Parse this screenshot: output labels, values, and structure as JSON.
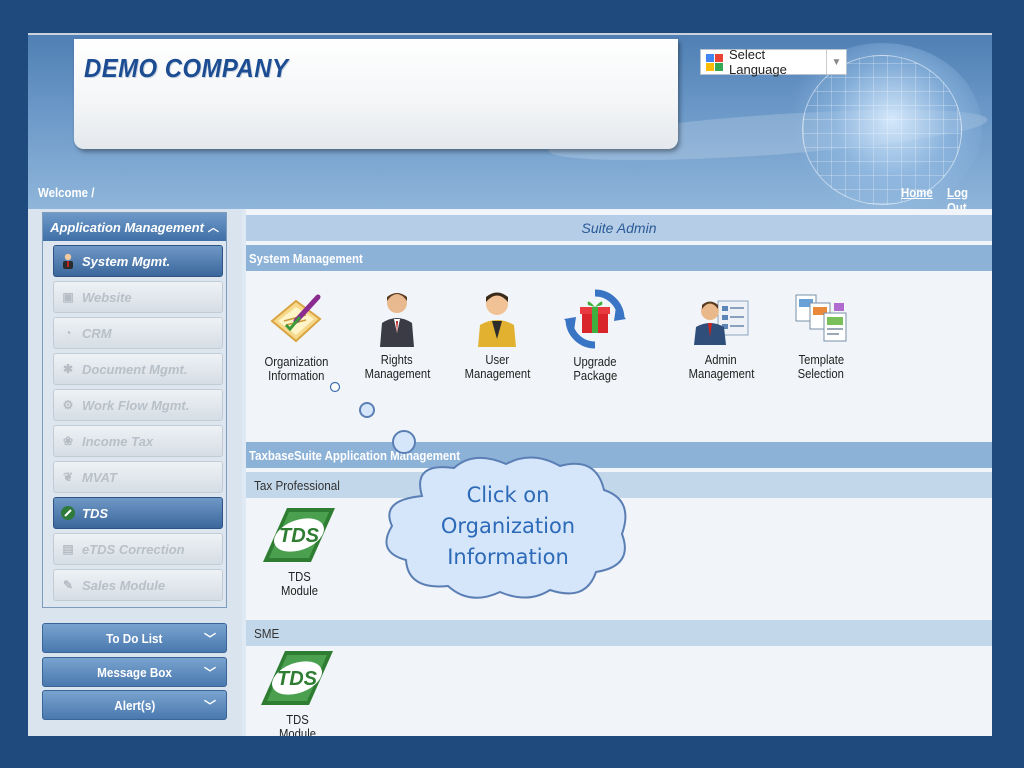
{
  "header": {
    "company_name": "DEMO COMPANY",
    "language_label": "Select Language",
    "welcome": "Welcome /",
    "home": "Home",
    "logout": "Log Out"
  },
  "sidebar": {
    "panel_title": "Application Management",
    "items": [
      {
        "label": "System Mgmt.",
        "icon": "admin-user-icon",
        "active": true
      },
      {
        "label": "Website",
        "icon": "website-icon",
        "active": false
      },
      {
        "label": "CRM",
        "icon": "crm-icon",
        "active": false
      },
      {
        "label": "Document Mgmt.",
        "icon": "document-icon",
        "active": false
      },
      {
        "label": "Work Flow Mgmt.",
        "icon": "workflow-icon",
        "active": false
      },
      {
        "label": "Income Tax",
        "icon": "income-tax-icon",
        "active": false
      },
      {
        "label": "MVAT",
        "icon": "mvat-icon",
        "active": false
      },
      {
        "label": "TDS",
        "icon": "tds-icon",
        "active": true
      },
      {
        "label": "eTDS Correction",
        "icon": "etds-icon",
        "active": false
      },
      {
        "label": "Sales Module",
        "icon": "sales-icon",
        "active": false
      }
    ],
    "bars": [
      {
        "label": "To Do List"
      },
      {
        "label": "Message Box"
      },
      {
        "label": "Alert(s)"
      }
    ]
  },
  "main": {
    "title": "Suite Admin",
    "system_section": "System Management",
    "system_tiles": [
      {
        "line1": "Organization",
        "line2": "Information",
        "icon": "organization-info-icon"
      },
      {
        "line1": "Rights",
        "line2": "Management",
        "icon": "rights-management-icon"
      },
      {
        "line1": "User",
        "line2": "Management",
        "icon": "user-management-icon"
      },
      {
        "line1": "Upgrade",
        "line2": "Package",
        "icon": "upgrade-package-icon"
      },
      {
        "line1": "Admin",
        "line2": "Management",
        "icon": "admin-management-icon"
      },
      {
        "line1": "Template",
        "line2": "Selection",
        "icon": "template-selection-icon"
      }
    ],
    "app_section": "TaxbaseSuite Application Management",
    "tax_professional": "Tax Professional",
    "sme": "SME",
    "tds_tile": {
      "line1": "TDS",
      "line2": "Module",
      "badge": "TDS"
    }
  },
  "callout": {
    "lines": [
      "Click on",
      "Organization",
      "Information"
    ]
  },
  "colors": {
    "page_background": "#1f4a7e",
    "accent_blue": "#3b679c",
    "section_bar": "#8db2d8",
    "callout_text": "#2c6ab8"
  }
}
